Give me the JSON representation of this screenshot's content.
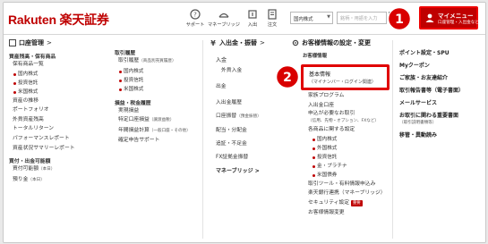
{
  "header": {
    "logo": "Rakuten 楽天証券",
    "nav": [
      {
        "label": "サポート",
        "icon": "support-icon"
      },
      {
        "label": "マネーブリッジ",
        "icon": "money-bridge-icon"
      },
      {
        "label": "入出",
        "icon": "deposit-icon"
      },
      {
        "label": "注文",
        "icon": "order-icon"
      }
    ],
    "market_select": "国内株式",
    "search_placeholder": "銘柄・用語を入力",
    "mymenu_title": "マイメニュー",
    "mymenu_sub": "口座管理・入出金など",
    "callout_1": "1",
    "accent": "#bf0000"
  },
  "col1": {
    "heading": "口座管理",
    "heading_arrow": ">",
    "sec1": "資産残高・保有商品",
    "items1": [
      "保有商品一覧"
    ],
    "subs1": [
      "国内株式",
      "投資信託",
      "米国株式"
    ],
    "items2": [
      "資産の推移",
      "ポートフォリオ",
      "外貨資産残高",
      "トータルリターン",
      "パフォーマンスレポート",
      "資産状況サマリーレポート"
    ],
    "sec2": "買付・出金可能額",
    "items3": [
      {
        "label": "買付可能額",
        "note": "（本日）"
      },
      {
        "label": "預り金",
        "note": "（本日）"
      }
    ]
  },
  "col2": {
    "sec1": "取引履歴",
    "item1": "取引履歴",
    "item1_note": "（商品別売買履歴）",
    "subs1": [
      "国内株式",
      "投資信託",
      "米国株式"
    ],
    "sec2": "損益・税金履歴",
    "items2": [
      {
        "label": "実現損益",
        "note": ""
      },
      {
        "label": "特定口座損益",
        "note": "（譲渡益税）"
      },
      {
        "label": "年間損益計算",
        "note": "（一般口座・その他）"
      },
      {
        "label": "確定申告サポート",
        "note": ""
      }
    ]
  },
  "col3": {
    "heading": "入出金・振替",
    "heading_arrow": ">",
    "items": [
      {
        "label": "入金",
        "note": ""
      },
      {
        "label": "外貨入金",
        "note": ""
      },
      {
        "label": "出金",
        "note": ""
      },
      {
        "label": "入出金履歴",
        "note": ""
      },
      {
        "label": "口座振替",
        "note": "（預金振替）"
      },
      {
        "label": "配当・分配金",
        "note": ""
      },
      {
        "label": "追証・不足金",
        "note": ""
      },
      {
        "label": "FX証拠金振替",
        "note": ""
      }
    ],
    "bridge": "マネーブリッジ",
    "bridge_arrow": ">"
  },
  "col4": {
    "heading": "お客様情報の設定・変更",
    "pre_item": "お客様情報",
    "highlight_title": "基本情報",
    "highlight_sub": "（マイナンバー・ログイン関連）",
    "callout_2": "2",
    "items": [
      "家族プログラム",
      "入出金口座",
      "申込が必要なお取引",
      "（信用、先物・オプション、FXなど）",
      "各商品に関する設定"
    ],
    "subs": [
      "国内株式",
      "外国株式",
      "投資信託",
      "金・プラチナ",
      "米国債券"
    ],
    "items2": [
      "取引ツール・有料情報申込み",
      "楽天銀行連携（マネーブリッジ）",
      "セキュリティ設定",
      "お客様情報変更"
    ],
    "security_badge": "重要"
  },
  "col5": {
    "items": [
      "ポイント設定・SPU",
      "Myクーポン",
      "ご家族・お友達紹介",
      "取引報告書等（電子書面）",
      "メールサービス",
      "お取引に関わる重要書面",
      "（取引説明書類等）",
      "移管・異動読み"
    ]
  }
}
